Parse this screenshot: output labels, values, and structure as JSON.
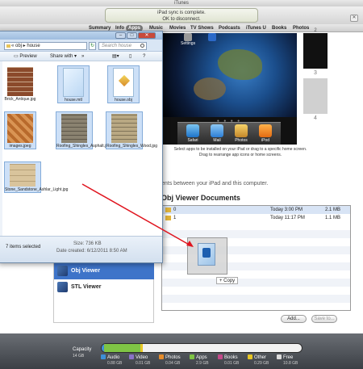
{
  "window": {
    "title": "iTunes"
  },
  "lcd": {
    "line1": "iPad sync is complete.",
    "line2": "OK to disconnect."
  },
  "tabs": [
    "Summary",
    "Info",
    "Apps",
    "Music",
    "Movies",
    "TV Shows",
    "Podcasts",
    "iTunes U",
    "Books",
    "Photos"
  ],
  "active_tab": "Apps",
  "ipad": {
    "top_apps": [
      "Settings"
    ],
    "dock_apps": [
      "Safari",
      "Mail",
      "Photos",
      "iPod"
    ],
    "page_numbers": [
      "2",
      "3",
      "4"
    ]
  },
  "instructions": {
    "line1": "Select apps to be installed on your iPad or drag to a specific home screen.",
    "line2": "Drag to rearrange app icons or home screens."
  },
  "file_sharing": {
    "partial_text": "ents between your iPad and this computer."
  },
  "docs": {
    "title": "Obj Viewer Documents",
    "rows": [
      {
        "name": "0",
        "date": "Today 3:00 PM",
        "size": "2.1 MB"
      },
      {
        "name": "1",
        "date": "Today 11:17 PM",
        "size": "1.1 MB"
      }
    ],
    "add_button": "Add...",
    "save_button": "Save to...",
    "copy_label": "Copy"
  },
  "apps_list": [
    "Obj Viewer",
    "STL Viewer"
  ],
  "capacity": {
    "label": "Capacity",
    "total": "14 GB",
    "legend": [
      {
        "name": "Audio",
        "value": "0.88 GB",
        "color": "#3d8fd8"
      },
      {
        "name": "Video",
        "value": "0.01 GB",
        "color": "#8a72c8"
      },
      {
        "name": "Photos",
        "value": "0.04 GB",
        "color": "#e58c2c"
      },
      {
        "name": "Apps",
        "value": "2.9 GB",
        "color": "#7fc445"
      },
      {
        "name": "Books",
        "value": "0.01 GB",
        "color": "#c34a8a"
      },
      {
        "name": "Other",
        "value": "0.29 GB",
        "color": "#e7c626"
      },
      {
        "name": "Free",
        "value": "10.8 GB",
        "color": "#dcdcdc"
      }
    ]
  },
  "explorer": {
    "breadcrumb": "« obj ▸ house",
    "search_placeholder": "Search house",
    "toolbar": {
      "preview": "Preview",
      "share": "Share with ▾"
    },
    "files": [
      {
        "name": "Brick_Antique.jpg",
        "kind": "brick"
      },
      {
        "name": "house.mtl",
        "kind": "mtldoc"
      },
      {
        "name": "house.obj",
        "kind": "objdoc"
      },
      {
        "name": "images.jpeg",
        "kind": "parquet"
      },
      {
        "name": "Roofing_Shingles_Asphalt.jpg",
        "kind": "shingle"
      },
      {
        "name": "Roofing_Shingles_Wood.jpg",
        "kind": "shingle2"
      },
      {
        "name": "Stone_Sandstone_Ashlar_Light.jpg",
        "kind": "sandstone"
      }
    ],
    "status": {
      "selected": "7 items selected",
      "size": "Size: 736 KB",
      "date": "Date created: 6/12/2011 8:50 AM"
    }
  }
}
